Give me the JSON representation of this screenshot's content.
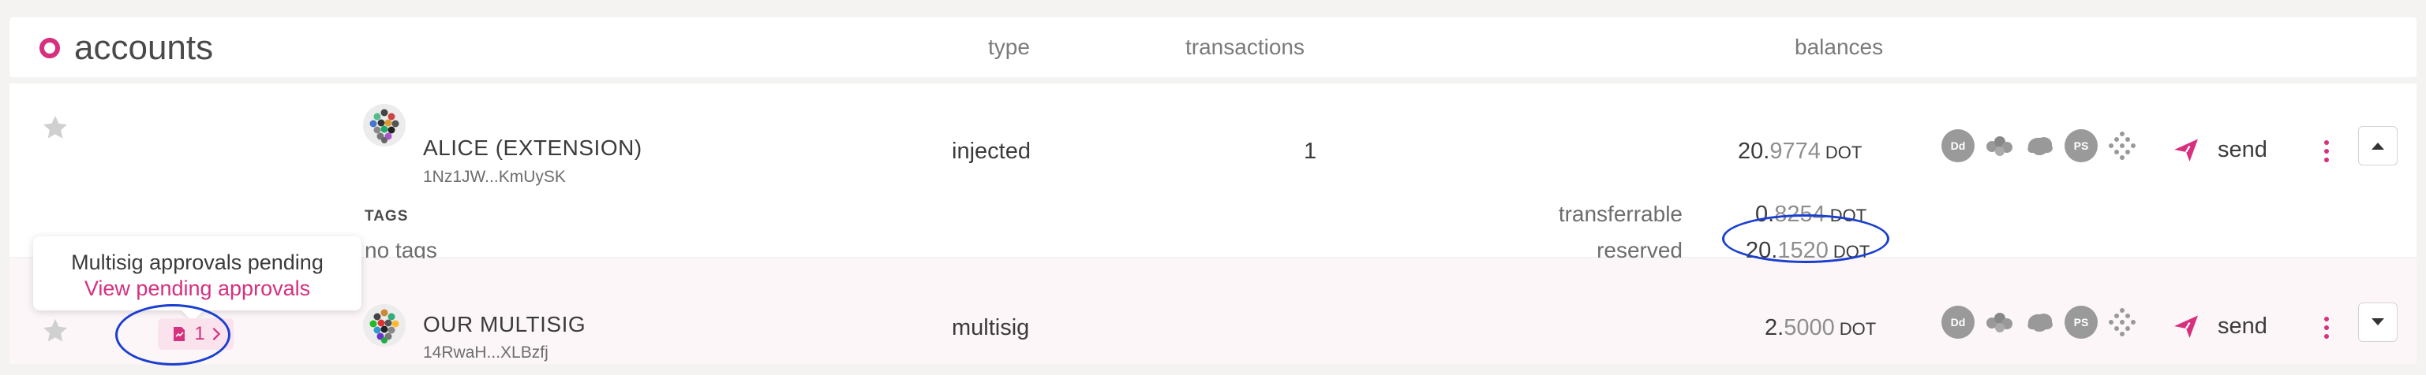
{
  "header": {
    "title": "accounts",
    "col_type": "type",
    "col_transactions": "transactions",
    "col_balances": "balances"
  },
  "accounts": [
    {
      "name": "ALICE (EXTENSION)",
      "address": "1Nz1JW...KmUySK",
      "type": "injected",
      "transactions": "1",
      "balance_int": "20.",
      "balance_frac": "9774",
      "unit": "DOT",
      "send_label": "send"
    },
    {
      "name": "OUR MULTISIG",
      "address": "14RwaH...XLBzfj",
      "type": "multisig",
      "transactions": "",
      "balance_int": "2.",
      "balance_frac": "5000",
      "unit": "DOT",
      "send_label": "send"
    }
  ],
  "details": {
    "tags_title": "TAGS",
    "no_tags": "no tags",
    "transferrable_label": "transferrable",
    "transferrable_int": "0.",
    "transferrable_frac": "8254",
    "reserved_label": "reserved",
    "reserved_int": "20.",
    "reserved_frac": "1520",
    "unit": "DOT"
  },
  "chain_icons": [
    "Dd",
    "",
    "",
    "PS",
    ""
  ],
  "tooltip": {
    "title": "Multisig approvals pending",
    "link": "View pending approvals"
  },
  "badge": {
    "count": "1"
  },
  "colors": {
    "accent": "#d6307f",
    "highlight": "#1a3fd0"
  }
}
